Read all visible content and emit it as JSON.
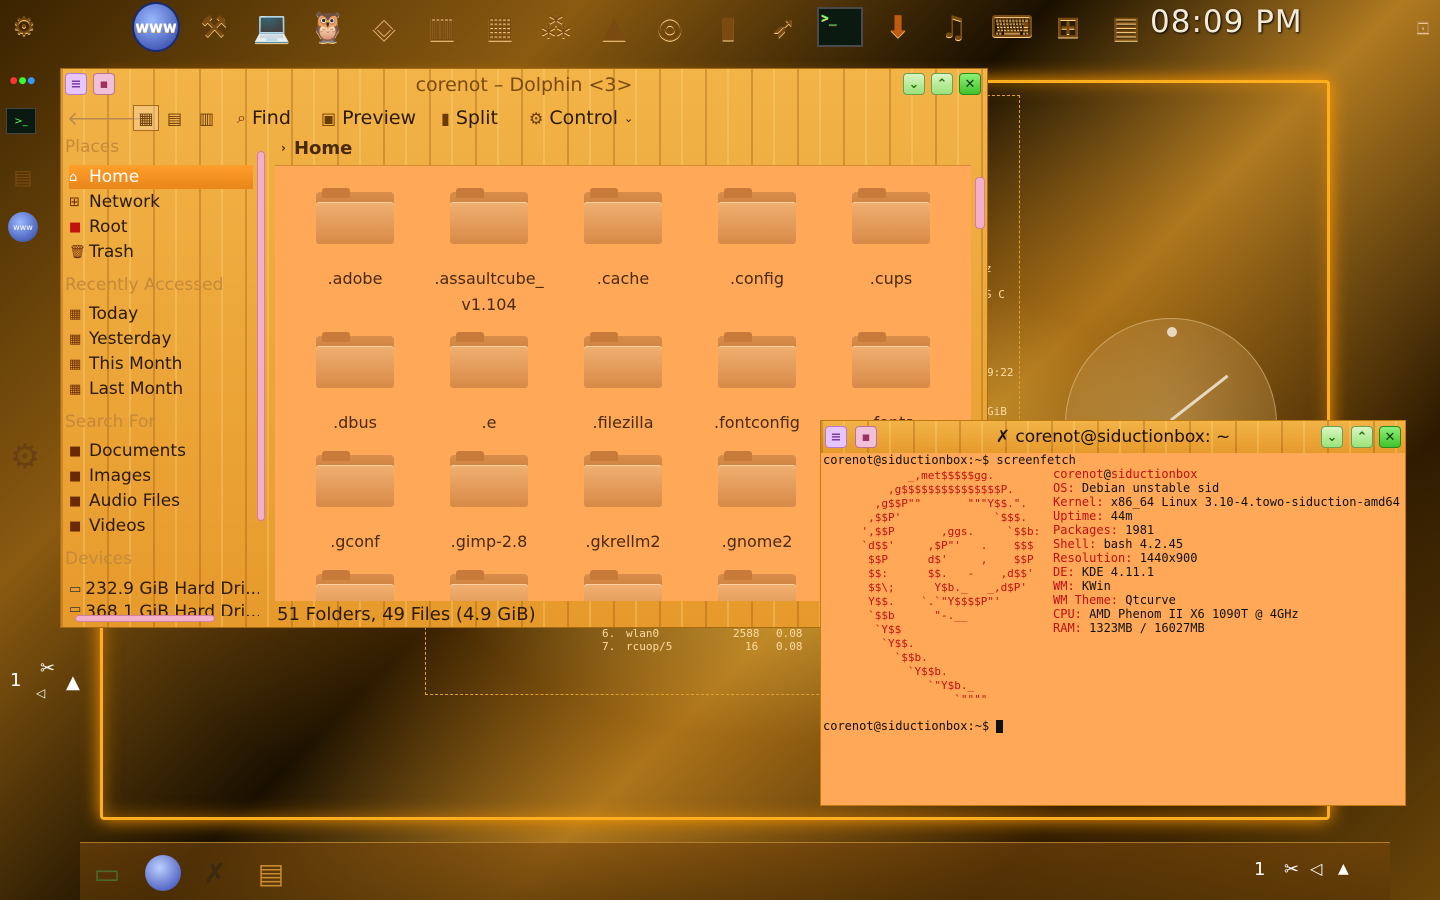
{
  "clock": {
    "time": "08:09 PM"
  },
  "top_panel": {
    "icons": [
      "kde-menu-icon",
      "browser-icon",
      "tools-icon",
      "computer-icon",
      "owl-icon",
      "diamond-icon",
      "chart-icon",
      "chart2-icon",
      "network-icon",
      "cone-icon",
      "disc-icon",
      "file-icon",
      "rocket-icon",
      "terminal-icon",
      "download-icon",
      "music-icon",
      "keyboard-icon",
      "calculator-icon",
      "document-icon"
    ],
    "browser_label": "www"
  },
  "dolphin": {
    "title": "corenot – Dolphin <3>",
    "toolbar": {
      "find": "Find",
      "preview": "Preview",
      "split": "Split",
      "control": "Control"
    },
    "places": {
      "places_header": "Places",
      "home": "Home",
      "network": "Network",
      "root": "Root",
      "trash": "Trash",
      "recent_header": "Recently Accessed",
      "today": "Today",
      "yesterday": "Yesterday",
      "this_month": "This Month",
      "last_month": "Last Month",
      "search_header": "Search For",
      "documents": "Documents",
      "images": "Images",
      "audio": "Audio Files",
      "videos": "Videos",
      "devices_header": "Devices",
      "disk1": "232.9 GiB Hard Dri...",
      "disk2": "368.1 GiB Hard Dri..."
    },
    "breadcrumb": "Home",
    "files": [
      ".adobe",
      ".assaultcube_\nv1.104",
      ".cache",
      ".config",
      ".cups",
      ".dbus",
      ".e",
      ".filezilla",
      ".fontconfig",
      ".fonts",
      ".gconf",
      ".gimp-2.8",
      ".gkrellm2",
      ".gnome2",
      "",
      "",
      "",
      ""
    ],
    "status": "51 Folders, 49 Files (4.9 GiB)"
  },
  "terminal": {
    "title": "corenot@siductionbox: ~",
    "prompt1": "corenot@siductionbox:~$ screenfetch",
    "user": "corenot",
    "at": "@",
    "host": "siductionbox",
    "info": [
      {
        "k": "OS:",
        "v": " Debian unstable sid"
      },
      {
        "k": "Kernel:",
        "v": " x86_64 Linux 3.10-4.towo-siduction-amd64"
      },
      {
        "k": "Uptime:",
        "v": " 44m"
      },
      {
        "k": "Packages:",
        "v": " 1981"
      },
      {
        "k": "Shell:",
        "v": " bash 4.2.45"
      },
      {
        "k": "Resolution:",
        "v": " 1440x900"
      },
      {
        "k": "DE:",
        "v": " KDE 4.11.1"
      },
      {
        "k": "WM:",
        "v": " KWin"
      },
      {
        "k": "WM Theme:",
        "v": " Qtcurve"
      },
      {
        "k": "CPU:",
        "v": " AMD Phenom II X6 1090T @ 4GHz"
      },
      {
        "k": "RAM:",
        "v": " 1323MB / 16027MB"
      }
    ],
    "logo": "           _,met$$$$$gg.\n        ,g$$$$$$$$$$$$$$$P.\n      ,g$$P\"\"       \"\"\"Y$$.\".\n     ,$$P'              `$$$.\n    ',$$P       ,ggs.     `$$b:\n    `d$$'     ,$P\"'   .    $$$\n     $$P      d$'     ,    $$P\n     $$:      $$.   -    ,d$$'\n     $$\\;      Y$b._   _,d$P'\n     Y$$.    `.`\"Y$$$$P\"'\n     `$$b      \"-.__\n      `Y$$\n       `Y$$.\n         `$$b.\n           `Y$$b.\n              `\"Y$b._\n                  `\"\"\"\"",
    "prompt2": "corenot@siductionbox:~$ "
  },
  "bg_terminal": {
    "rows": [
      {
        "idx": "6.",
        "name": "wlan0",
        "a": "2588",
        "b": "0.08"
      },
      {
        "idx": "7.",
        "name": "rcuop/5",
        "a": "16",
        "b": "0.08"
      }
    ],
    "fragments": [
      "z",
      "S C",
      "9:22",
      "GiB"
    ]
  },
  "tray": {
    "counter": "1"
  }
}
